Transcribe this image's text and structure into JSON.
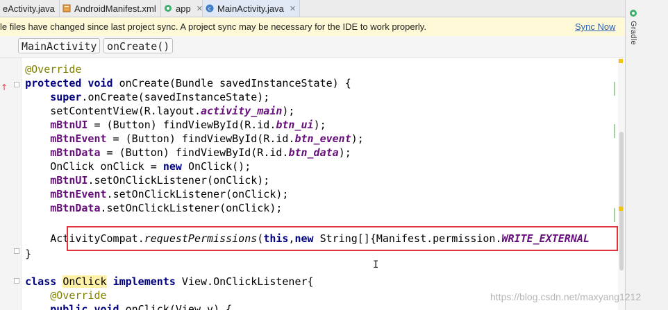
{
  "tabs": [
    {
      "label": "eActivity.java",
      "icon": "java-class-icon"
    },
    {
      "label": "AndroidManifest.xml",
      "icon": "manifest-icon"
    },
    {
      "label": "app",
      "icon": "gradle-icon"
    },
    {
      "label": "MainActivity.java",
      "icon": "java-class-icon",
      "active": true
    }
  ],
  "notice": {
    "text": "le files have changed since last project sync. A project sync may be necessary for the IDE to work properly.",
    "link": "Sync Now"
  },
  "breadcrumbs": [
    "MainActivity",
    "onCreate()"
  ],
  "side_panel": {
    "label": "Gradle"
  },
  "code_lines": [
    "    @Override",
    "    protected void onCreate(Bundle savedInstanceState) {",
    "        super.onCreate(savedInstanceState);",
    "        setContentView(R.layout.activity_main);",
    "        mBtnUI = (Button) findViewById(R.id.btn_ui);",
    "        mBtnEvent = (Button) findViewById(R.id.btn_event);",
    "        mBtnData = (Button) findViewById(R.id.btn_data);",
    "        OnClick onClick = new OnClick();",
    "        mBtnUI.setOnClickListener(onClick);",
    "        mBtnEvent.setOnClickListener(onClick);",
    "        mBtnData.setOnClickListener(onClick);",
    "",
    "        ActivityCompat.requestPermissions(this,new String[]{Manifest.permission.WRITE_EXTERNAL",
    "    }",
    "",
    "    class OnClick implements View.OnClickListener{",
    "        @Override",
    "        public void onClick(View v) {"
  ],
  "watermark": "https://blog.csdn.net/maxyang1212",
  "colors": {
    "keyword": "#000080",
    "annotation": "#808000",
    "field": "#660e7a",
    "highlight_box": "#e0343a",
    "notice_bg": "#fff9d7",
    "link": "#2a5fb3"
  }
}
